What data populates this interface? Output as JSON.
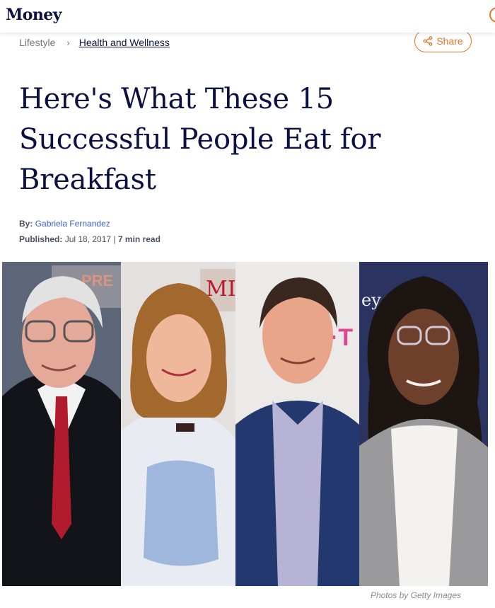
{
  "header": {
    "logo": "Money"
  },
  "breadcrumb": {
    "items": [
      "Lifestyle",
      "Health and Wellness"
    ],
    "separator": "›"
  },
  "share": {
    "label": "Share",
    "icon": "share-icon"
  },
  "article": {
    "title": "Here's What These 15 Successful People Eat for Breakfast",
    "byline_label": "By:",
    "author": "Gabriela Fernandez",
    "published_label": "Published:",
    "published_date": "Jul 18, 2017",
    "divider": "|",
    "read_time": "7 min read"
  },
  "image": {
    "credit": "Photos by Getty Images"
  },
  "colors": {
    "accent": "#e8742c",
    "headline": "#0b1140",
    "link": "#3b5bdb"
  }
}
